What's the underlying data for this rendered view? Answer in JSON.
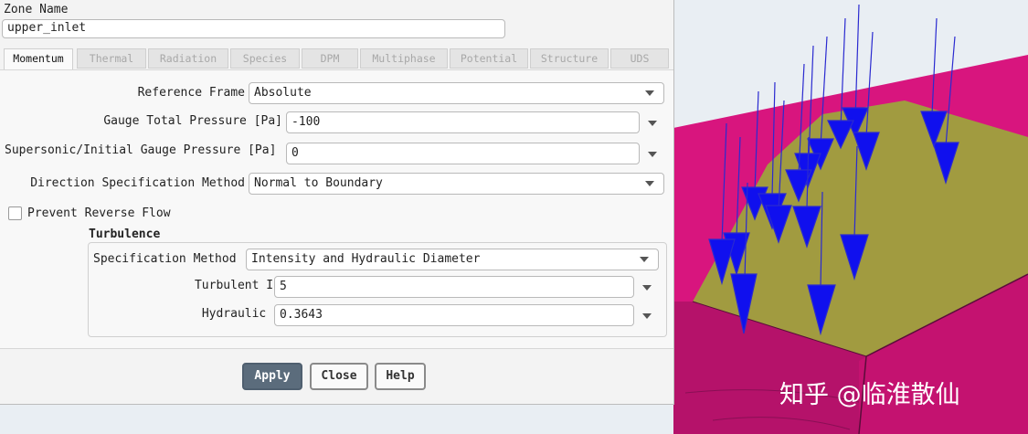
{
  "zone": {
    "label": "Zone Name",
    "value": "upper_inlet"
  },
  "tabs": [
    "Momentum",
    "Thermal",
    "Radiation",
    "Species",
    "DPM",
    "Multiphase",
    "Potential",
    "Structure",
    "UDS"
  ],
  "momentum": {
    "reference_frame": {
      "label": "Reference Frame",
      "value": "Absolute"
    },
    "gauge_total_pressure": {
      "label": "Gauge Total Pressure [Pa]",
      "value": "-100"
    },
    "supersonic_pressure": {
      "label": "Supersonic/Initial Gauge Pressure [Pa]",
      "value": "0"
    },
    "direction_method": {
      "label": "Direction Specification Method",
      "value": "Normal to Boundary"
    },
    "prevent_reverse_flow": {
      "label": "Prevent Reverse Flow",
      "checked": false
    }
  },
  "turbulence": {
    "heading": "Turbulence",
    "spec_method": {
      "label": "Specification Method",
      "value": "Intensity and Hydraulic Diameter"
    },
    "intensity": {
      "label": "Turbulent Intensity [%]",
      "value": "5"
    },
    "hydraulic_diameter": {
      "label": "Hydraulic Diameter [m]",
      "value": "0.3643"
    }
  },
  "buttons": {
    "apply": "Apply",
    "close": "Close",
    "help": "Help"
  },
  "watermark": "知乎 @临淮散仙",
  "colors": {
    "magenta": "#d8157e",
    "olive": "#a19b40",
    "arrow_blue": "#1010ee",
    "background": "#e9eef3"
  }
}
